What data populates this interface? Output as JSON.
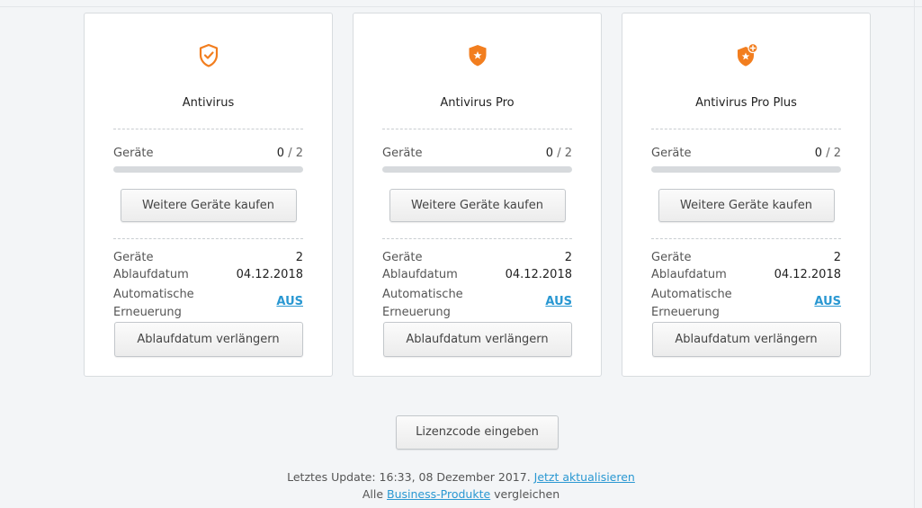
{
  "colors": {
    "accent": "#f27e1f",
    "link": "#2a98d2"
  },
  "products": [
    {
      "icon": "shield-check-outline-icon",
      "name": "Antivirus",
      "devices_label": "Geräte",
      "devices_used": "0",
      "devices_sep": " / ",
      "devices_total": "2",
      "usage_fraction": 0,
      "buy_label": "Weitere Geräte kaufen",
      "info_devices_label": "Geräte",
      "info_devices_value": "2",
      "expiry_label": "Ablaufdatum",
      "expiry_value": "04.12.2018",
      "renewal_label": "Automatische Erneuerung",
      "renewal_value": "AUS",
      "extend_label": "Ablaufdatum verlängern"
    },
    {
      "icon": "shield-star-icon",
      "name": "Antivirus Pro",
      "devices_label": "Geräte",
      "devices_used": "0",
      "devices_sep": " / ",
      "devices_total": "2",
      "usage_fraction": 0,
      "buy_label": "Weitere Geräte kaufen",
      "info_devices_label": "Geräte",
      "info_devices_value": "2",
      "expiry_label": "Ablaufdatum",
      "expiry_value": "04.12.2018",
      "renewal_label": "Automatische Erneuerung",
      "renewal_value": "AUS",
      "extend_label": "Ablaufdatum verlängern"
    },
    {
      "icon": "shield-star-plus-icon",
      "name": "Antivirus Pro Plus",
      "devices_label": "Geräte",
      "devices_used": "0",
      "devices_sep": " / ",
      "devices_total": "2",
      "usage_fraction": 0,
      "buy_label": "Weitere Geräte kaufen",
      "info_devices_label": "Geräte",
      "info_devices_value": "2",
      "expiry_label": "Ablaufdatum",
      "expiry_value": "04.12.2018",
      "renewal_label": "Automatische Erneuerung",
      "renewal_value": "AUS",
      "extend_label": "Ablaufdatum verlängern"
    }
  ],
  "license_button": "Lizenzcode eingeben",
  "footer": {
    "update_text": "Letztes Update: 16:33, 08 Dezember 2017.",
    "refresh_link": "Jetzt aktualisieren",
    "compare_prefix": "Alle",
    "business_link": "Business-Produkte",
    "compare_suffix": "vergleichen"
  }
}
